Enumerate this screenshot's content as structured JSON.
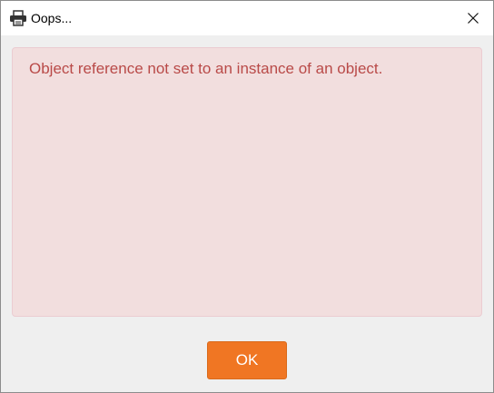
{
  "window": {
    "title": "Oops...",
    "app_icon": "printer-icon",
    "close_icon": "close-icon"
  },
  "error": {
    "message": "Object reference not set to an instance of an object.",
    "background_color": "#f2dede",
    "text_color": "#b94a48"
  },
  "actions": {
    "ok_label": "OK",
    "ok_color": "#f07623"
  }
}
